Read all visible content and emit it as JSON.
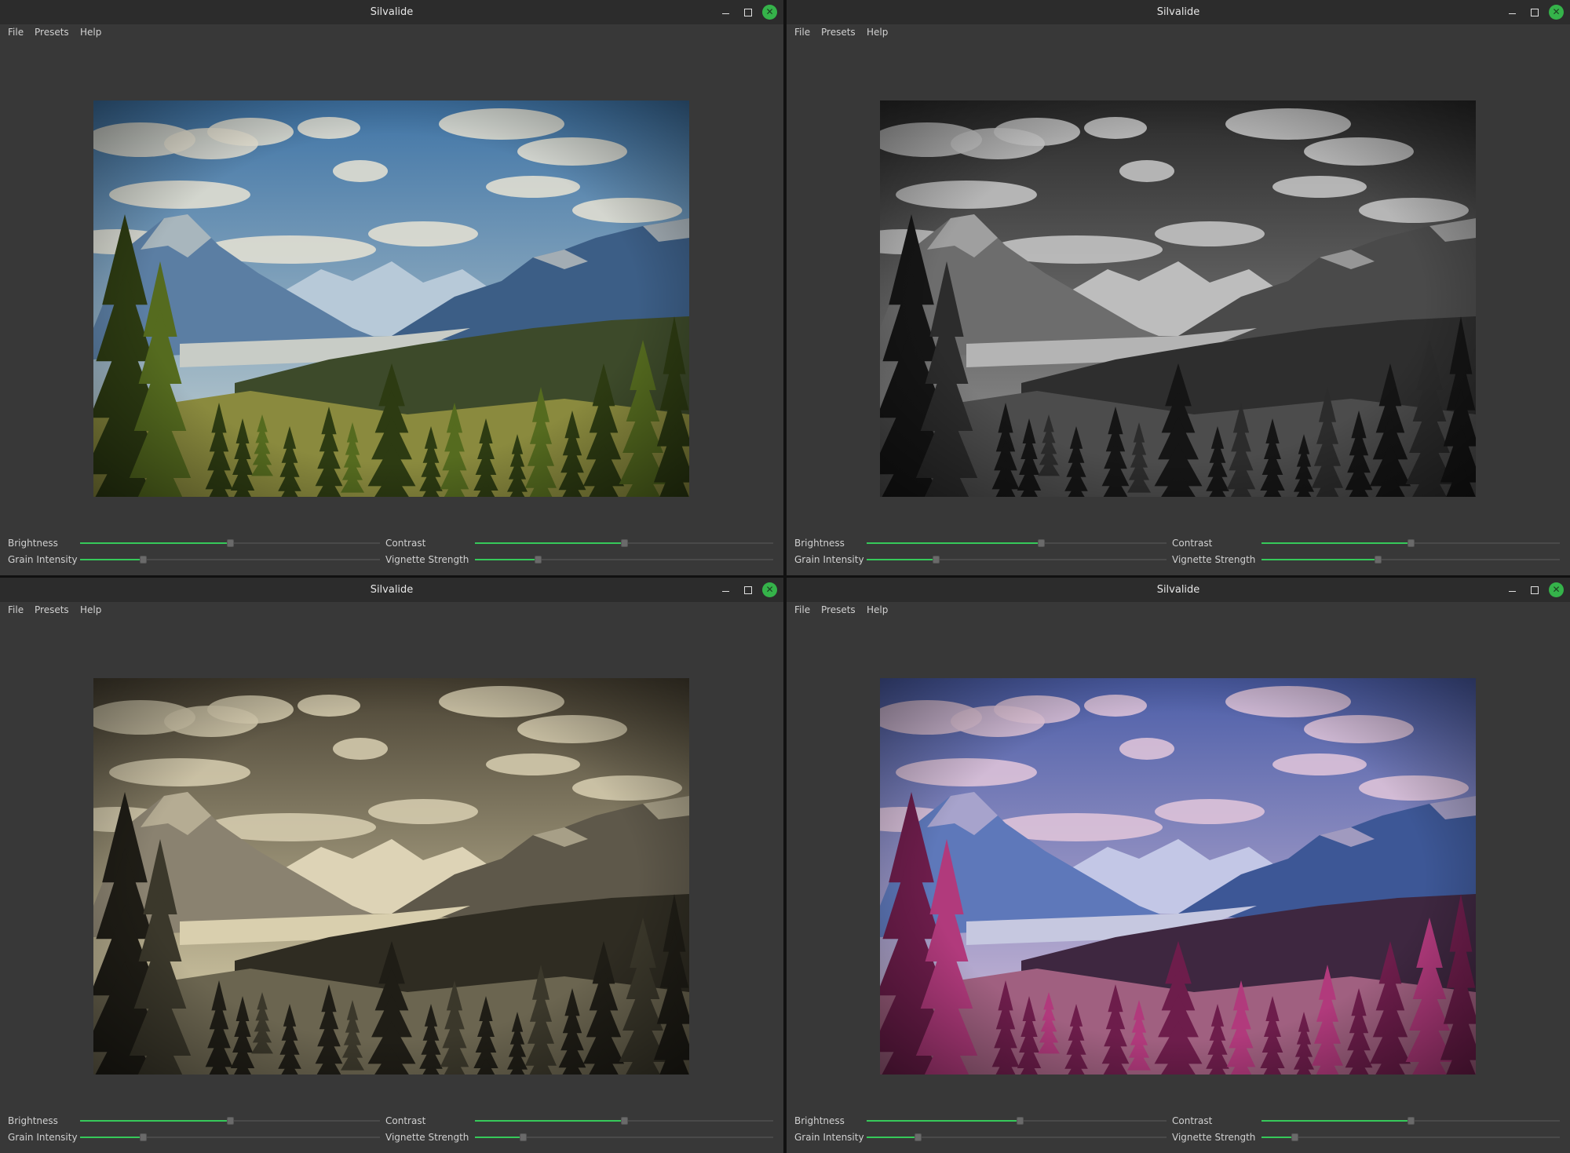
{
  "windows": [
    {
      "title": "Silvalide",
      "menu": [
        "File",
        "Presets",
        "Help"
      ],
      "variant": "color",
      "palette": {
        "skyTop": "#3f74a6",
        "skyBottom": "#c9d4d2",
        "cloud": "#e8e3d3",
        "mountFar": "#b7c9d8",
        "mountMid": "#5b7ea3",
        "mountNear": "#3c5e86",
        "valley": "#c8ccc6",
        "hill": "#3d4a2a",
        "meadow": "#8a8a3e",
        "tree": "#2d3b12",
        "treeLight": "#556b1f"
      },
      "sliders": {
        "brightness": {
          "label": "Brightness",
          "value": 0.5
        },
        "contrast": {
          "label": "Contrast",
          "value": 0.5
        },
        "grain": {
          "label": "Grain Intensity",
          "value": 0.21
        },
        "vignette": {
          "label": "Vignette Strength",
          "value": 0.21
        }
      }
    },
    {
      "title": "Silvalide",
      "menu": [
        "File",
        "Presets",
        "Help"
      ],
      "variant": "mono",
      "palette": {
        "skyTop": "#2a2a2a",
        "skyBottom": "#9a9a9a",
        "cloud": "#c9c9c9",
        "mountFar": "#bdbdbd",
        "mountMid": "#6d6d6d",
        "mountNear": "#4a4a4a",
        "valley": "#b4b4b4",
        "hill": "#2e2e2e",
        "meadow": "#4c4c4c",
        "tree": "#151515",
        "treeLight": "#2c2c2c"
      },
      "sliders": {
        "brightness": {
          "label": "Brightness",
          "value": 0.58
        },
        "contrast": {
          "label": "Contrast",
          "value": 0.5
        },
        "grain": {
          "label": "Grain Intensity",
          "value": 0.23
        },
        "vignette": {
          "label": "Vignette Strength",
          "value": 0.39
        }
      }
    },
    {
      "title": "Silvalide",
      "menu": [
        "File",
        "Presets",
        "Help"
      ],
      "variant": "sepia",
      "palette": {
        "skyTop": "#4a4334",
        "skyBottom": "#e9dfb8",
        "cloud": "#d8cfb1",
        "mountFar": "#ddd3b6",
        "mountMid": "#8a8270",
        "mountNear": "#5e584a",
        "valley": "#d9cfae",
        "hill": "#2f2c22",
        "meadow": "#6b6550",
        "tree": "#1f1d16",
        "treeLight": "#3b382b"
      },
      "sliders": {
        "brightness": {
          "label": "Brightness",
          "value": 0.5
        },
        "contrast": {
          "label": "Contrast",
          "value": 0.5
        },
        "grain": {
          "label": "Grain Intensity",
          "value": 0.21
        },
        "vignette": {
          "label": "Vignette Strength",
          "value": 0.16
        }
      }
    },
    {
      "title": "Silvalide",
      "menu": [
        "File",
        "Presets",
        "Help"
      ],
      "variant": "infrared",
      "palette": {
        "skyTop": "#4c5ea8",
        "skyBottom": "#d9c3dc",
        "cloud": "#e3c7da",
        "mountFar": "#c3c7e6",
        "mountMid": "#5e78ba",
        "mountNear": "#3d5796",
        "valley": "#c6c8e0",
        "hill": "#3e2740",
        "meadow": "#a06080",
        "tree": "#6d1d4b",
        "treeLight": "#b13a7c"
      },
      "sliders": {
        "brightness": {
          "label": "Brightness",
          "value": 0.51
        },
        "contrast": {
          "label": "Contrast",
          "value": 0.5
        },
        "grain": {
          "label": "Grain Intensity",
          "value": 0.17
        },
        "vignette": {
          "label": "Vignette Strength",
          "value": 0.11
        }
      }
    }
  ]
}
